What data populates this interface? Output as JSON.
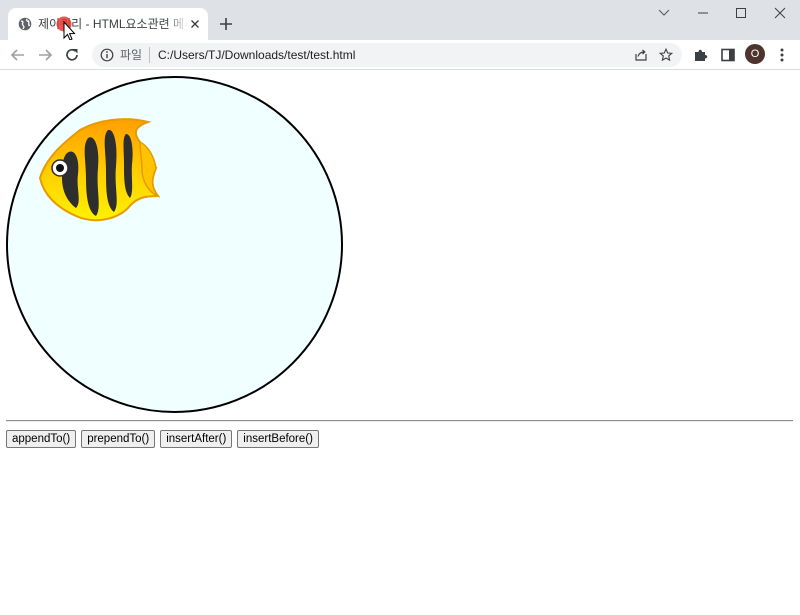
{
  "browser": {
    "tab": {
      "title": "제이쿼리 - HTML요소관련 메서드",
      "favicon": "globe-icon",
      "close": "close-icon"
    },
    "new_tab": "plus-icon",
    "window_controls": [
      "chevron-down-icon",
      "minimize-icon",
      "maximize-icon",
      "close-icon"
    ],
    "toolbar": {
      "nav": [
        "back-arrow-icon",
        "forward-arrow-icon",
        "reload-icon"
      ],
      "omnibox": {
        "chip": "파일",
        "url": "C:/Users/TJ/Downloads/test/test.html"
      },
      "actions": [
        "share-icon",
        "star-icon",
        "extensions-icon",
        "side-panel-icon"
      ],
      "profile_initial": "O",
      "menu": "kebab-menu-icon"
    }
  },
  "page": {
    "fish": "tropical-fish-icon",
    "buttons": [
      {
        "label": "appendTo()"
      },
      {
        "label": "prependTo()"
      },
      {
        "label": "insertAfter()"
      },
      {
        "label": "insertBefore()"
      }
    ]
  },
  "colors": {
    "tabstrip": "#dee1e6",
    "omnibox": "#f1f3f4",
    "bowl_fill": "#f0ffff",
    "avatar": "#4e342e"
  }
}
